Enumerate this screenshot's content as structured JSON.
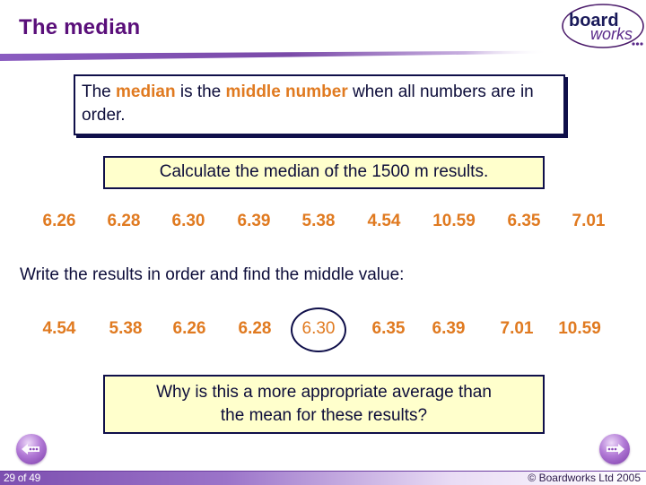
{
  "slide": {
    "title": "The median",
    "logo": {
      "line1": "board",
      "line2": "works"
    }
  },
  "definition": {
    "part1": "The ",
    "highlight1": "median",
    "part2": " is the ",
    "highlight2": "middle number",
    "part3": " when all numbers are in order."
  },
  "task": {
    "label": "Calculate the median of the 1500 m results."
  },
  "results": {
    "unordered": [
      "6.26",
      "6.28",
      "6.30",
      "6.39",
      "5.38",
      "4.54",
      "10.59",
      "6.35",
      "7.01"
    ],
    "instruction": "Write the results in order and find the middle value:",
    "ordered": [
      "4.54",
      "5.38",
      "6.26",
      "6.28",
      "6.30",
      "6.35",
      "6.39",
      "7.01",
      "10.59"
    ],
    "median_value": "6.30"
  },
  "question": {
    "line1": "Why is this a more appropriate average than",
    "line2": "the mean for these results?"
  },
  "navigation": {
    "prev_icon": "back-arrow-icon",
    "next_icon": "forward-arrow-icon"
  },
  "footer": {
    "page_indicator": "29 of 49",
    "copyright": "© Boardworks Ltd 2005"
  },
  "colors": {
    "title": "#5a0f7a",
    "highlight": "#e07a20",
    "box_border": "#0f0f4a",
    "box_fill": "#ffffcc"
  }
}
